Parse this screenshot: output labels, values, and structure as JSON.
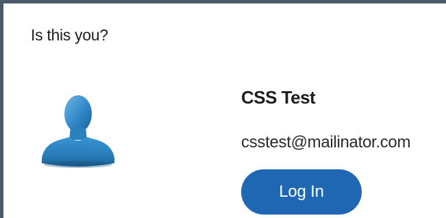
{
  "dialog": {
    "title": "Is this you?"
  },
  "account": {
    "name": "CSS Test",
    "email": "csstest@mailinator.com",
    "avatar_icon": "user-silhouette-icon"
  },
  "actions": {
    "login_label": "Log In"
  },
  "colors": {
    "button_bg": "#1f67b3",
    "avatar_blue": "#2f87c8",
    "border": "#4a5a68"
  }
}
